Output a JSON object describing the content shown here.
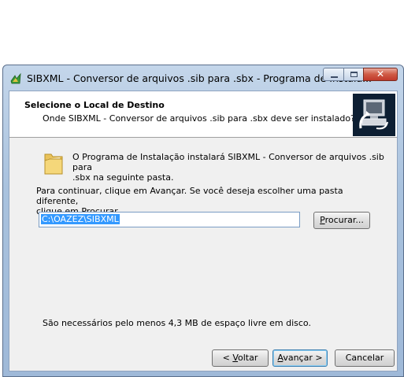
{
  "window": {
    "title": "SIBXML - Conversor de arquivos .sib para .sbx - Programa de Instala..."
  },
  "header": {
    "title": "Selecione o Local de Destino",
    "subtitle": "Onde SIBXML - Conversor de arquivos .sib para .sbx deve ser instalado?"
  },
  "body": {
    "info_line1": "O Programa de Instalação instalará SIBXML - Conversor de arquivos .sib para",
    "info_line2": ".sbx na seguinte pasta.",
    "prompt_line1": "Para continuar, clique em Avançar. Se você deseja escolher uma pasta diferente,",
    "prompt_line2": "clique em Procurar.",
    "path_value": "C:\\OAZEZ\\SIBXML",
    "browse_pre": "",
    "browse_accel": "P",
    "browse_post": "rocurar...",
    "space_required": "São necessários pelo menos 4,3 MB de espaço livre em disco."
  },
  "buttons": {
    "back_pre": "< ",
    "back_accel": "V",
    "back_post": "oltar",
    "next_pre": "",
    "next_accel": "A",
    "next_post": "vançar >",
    "cancel": "Cancelar"
  },
  "icons": {
    "app": "installer-icon",
    "folder": "folder-icon",
    "header": "computer-install-icon"
  }
}
